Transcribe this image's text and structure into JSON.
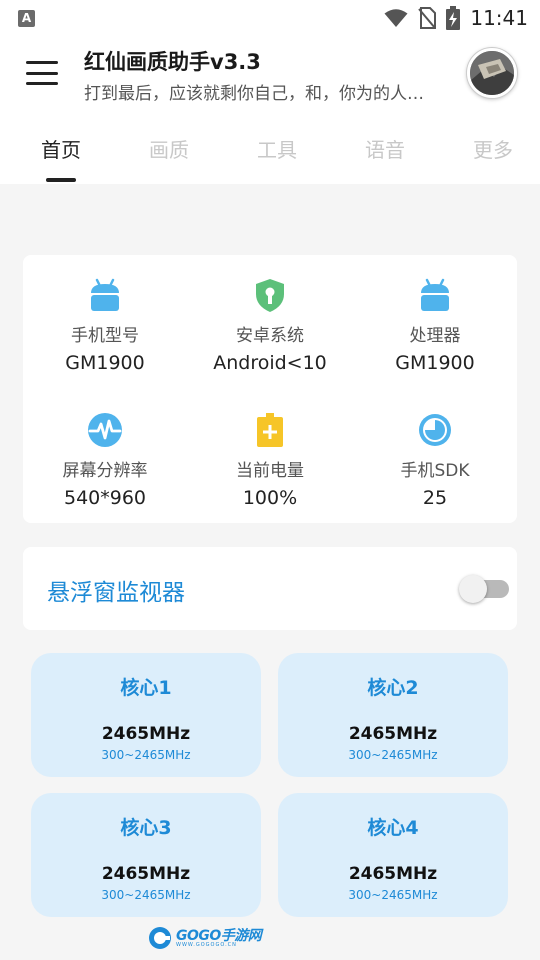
{
  "status_bar": {
    "notification_glyph": "A",
    "time": "11:41",
    "icons": [
      "wifi-icon",
      "no-sim-icon",
      "battery-charging-icon"
    ]
  },
  "app_bar": {
    "title": "红仙画质助手v3.3",
    "subtitle": "打到最后，应该就剩你自己，和，你为的人…"
  },
  "tabs": [
    {
      "label": "首页",
      "active": true
    },
    {
      "label": "画质",
      "active": false
    },
    {
      "label": "工具",
      "active": false
    },
    {
      "label": "语音",
      "active": false
    },
    {
      "label": "更多",
      "active": false
    }
  ],
  "device_info": [
    {
      "icon": "android-icon",
      "label": "手机型号",
      "value": "GM1900"
    },
    {
      "icon": "shield-icon",
      "label": "安卓系统",
      "value": "Android<10"
    },
    {
      "icon": "android-icon",
      "label": "处理器",
      "value": "GM1900"
    },
    {
      "icon": "pulse-icon",
      "label": "屏幕分辨率",
      "value": "540*960"
    },
    {
      "icon": "battery-icon",
      "label": "当前电量",
      "value": "100%"
    },
    {
      "icon": "pie-icon",
      "label": "手机SDK",
      "value": "25"
    }
  ],
  "floating_monitor": {
    "label": "悬浮窗监视器",
    "enabled": false
  },
  "cores": [
    {
      "title": "核心1",
      "freq": "2465MHz",
      "range": "300~2465MHz"
    },
    {
      "title": "核心2",
      "freq": "2465MHz",
      "range": "300~2465MHz"
    },
    {
      "title": "核心3",
      "freq": "2465MHz",
      "range": "300~2465MHz"
    },
    {
      "title": "核心4",
      "freq": "2465MHz",
      "range": "300~2465MHz"
    }
  ],
  "watermark": {
    "text": "GOGO手游网",
    "subtext": "WWW.GOGOGO.CN"
  },
  "colors": {
    "accent": "#1e8ad6",
    "icon_blue": "#4fb3ec",
    "icon_green": "#5cc07a",
    "icon_yellow": "#f6c528",
    "core_bg": "#dceefb"
  }
}
